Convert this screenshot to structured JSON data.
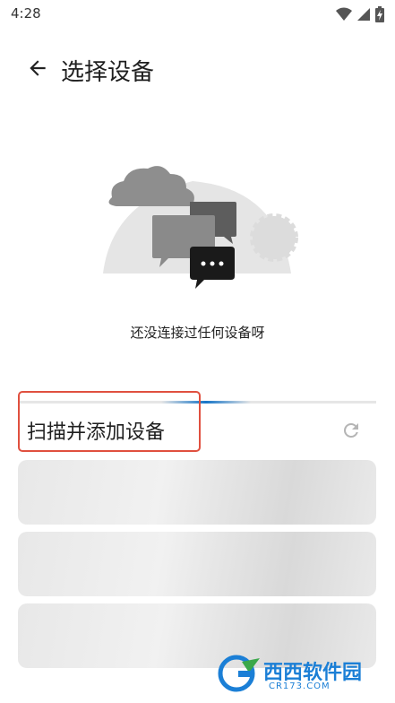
{
  "status_bar": {
    "time": "4:28",
    "icons": [
      "wifi-icon",
      "signal-icon",
      "battery-charging-icon"
    ]
  },
  "app_bar": {
    "back_icon": "arrow-back-icon",
    "title": "选择设备"
  },
  "empty_state": {
    "message": "还没连接过任何设备呀"
  },
  "scan": {
    "title": "扫描并添加设备",
    "refresh_icon": "refresh-icon",
    "highlight_color": "#e0503f",
    "progress_color": "#1775c7"
  },
  "device_placeholders": [
    {
      "state": "loading"
    },
    {
      "state": "loading"
    },
    {
      "state": "loading"
    }
  ],
  "watermark": {
    "title": "西西软件园",
    "subtitle": "CR173.COM"
  }
}
